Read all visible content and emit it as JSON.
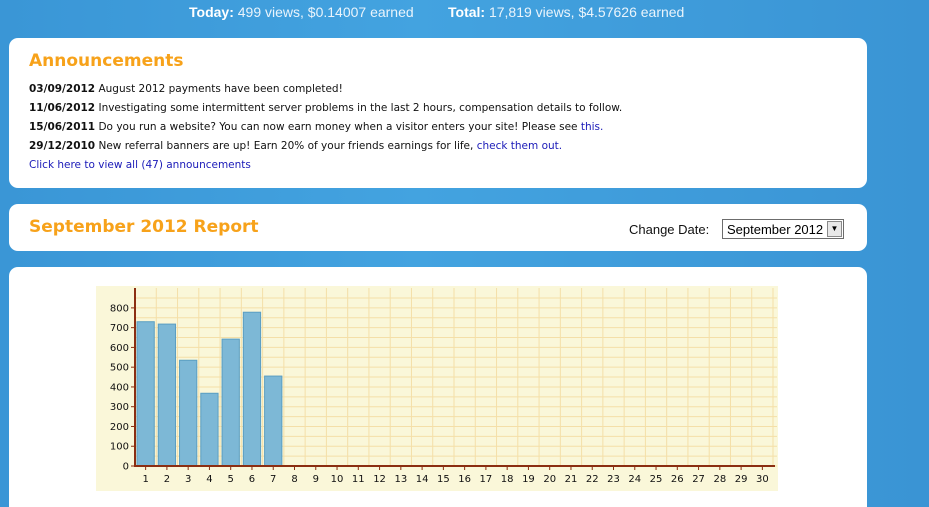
{
  "header": {
    "today_label": "Today:",
    "today_value": "499 views, $0.14007 earned",
    "total_label": "Total:",
    "total_value": "17,819 views, $4.57626 earned"
  },
  "announcements": {
    "title": "Announcements",
    "items": [
      {
        "date": "03/09/2012",
        "text": "August 2012 payments have been completed!",
        "link": ""
      },
      {
        "date": "11/06/2012",
        "text": "Investigating some intermittent server problems in the last 2 hours, compensation details to follow.",
        "link": ""
      },
      {
        "date": "15/06/2011",
        "text": "Do you run a website? You can now earn money when a visitor enters your site! Please see",
        "link": "this."
      },
      {
        "date": "29/12/2010",
        "text": "New referral banners are up! Earn 20% of your friends earnings for life,",
        "link": "check them out."
      }
    ],
    "view_all": "Click here to view all (47) announcements"
  },
  "report": {
    "title": "September 2012 Report",
    "change_date_label": "Change Date:",
    "selected_month": "September 2012",
    "arrow_glyph": "▼"
  },
  "chart_data": {
    "type": "bar",
    "categories": [
      "1",
      "2",
      "3",
      "4",
      "5",
      "6",
      "7",
      "8",
      "9",
      "10",
      "11",
      "12",
      "13",
      "14",
      "15",
      "16",
      "17",
      "18",
      "19",
      "20",
      "21",
      "22",
      "23",
      "24",
      "25",
      "26",
      "27",
      "28",
      "29",
      "30"
    ],
    "values": [
      730,
      718,
      535,
      368,
      642,
      778,
      455,
      0,
      0,
      0,
      0,
      0,
      0,
      0,
      0,
      0,
      0,
      0,
      0,
      0,
      0,
      0,
      0,
      0,
      0,
      0,
      0,
      0,
      0,
      0
    ],
    "ylim": [
      0,
      850
    ],
    "yticks": [
      "0",
      "100",
      "200",
      "300",
      "400",
      "500",
      "600",
      "700",
      "800"
    ],
    "grid": true,
    "colors": {
      "background": "#faf7d9",
      "grid": "#f4dfa8",
      "bar": "#7db8d6",
      "bar_border": "#5a9ec2",
      "axis": "#8b2e12"
    }
  }
}
